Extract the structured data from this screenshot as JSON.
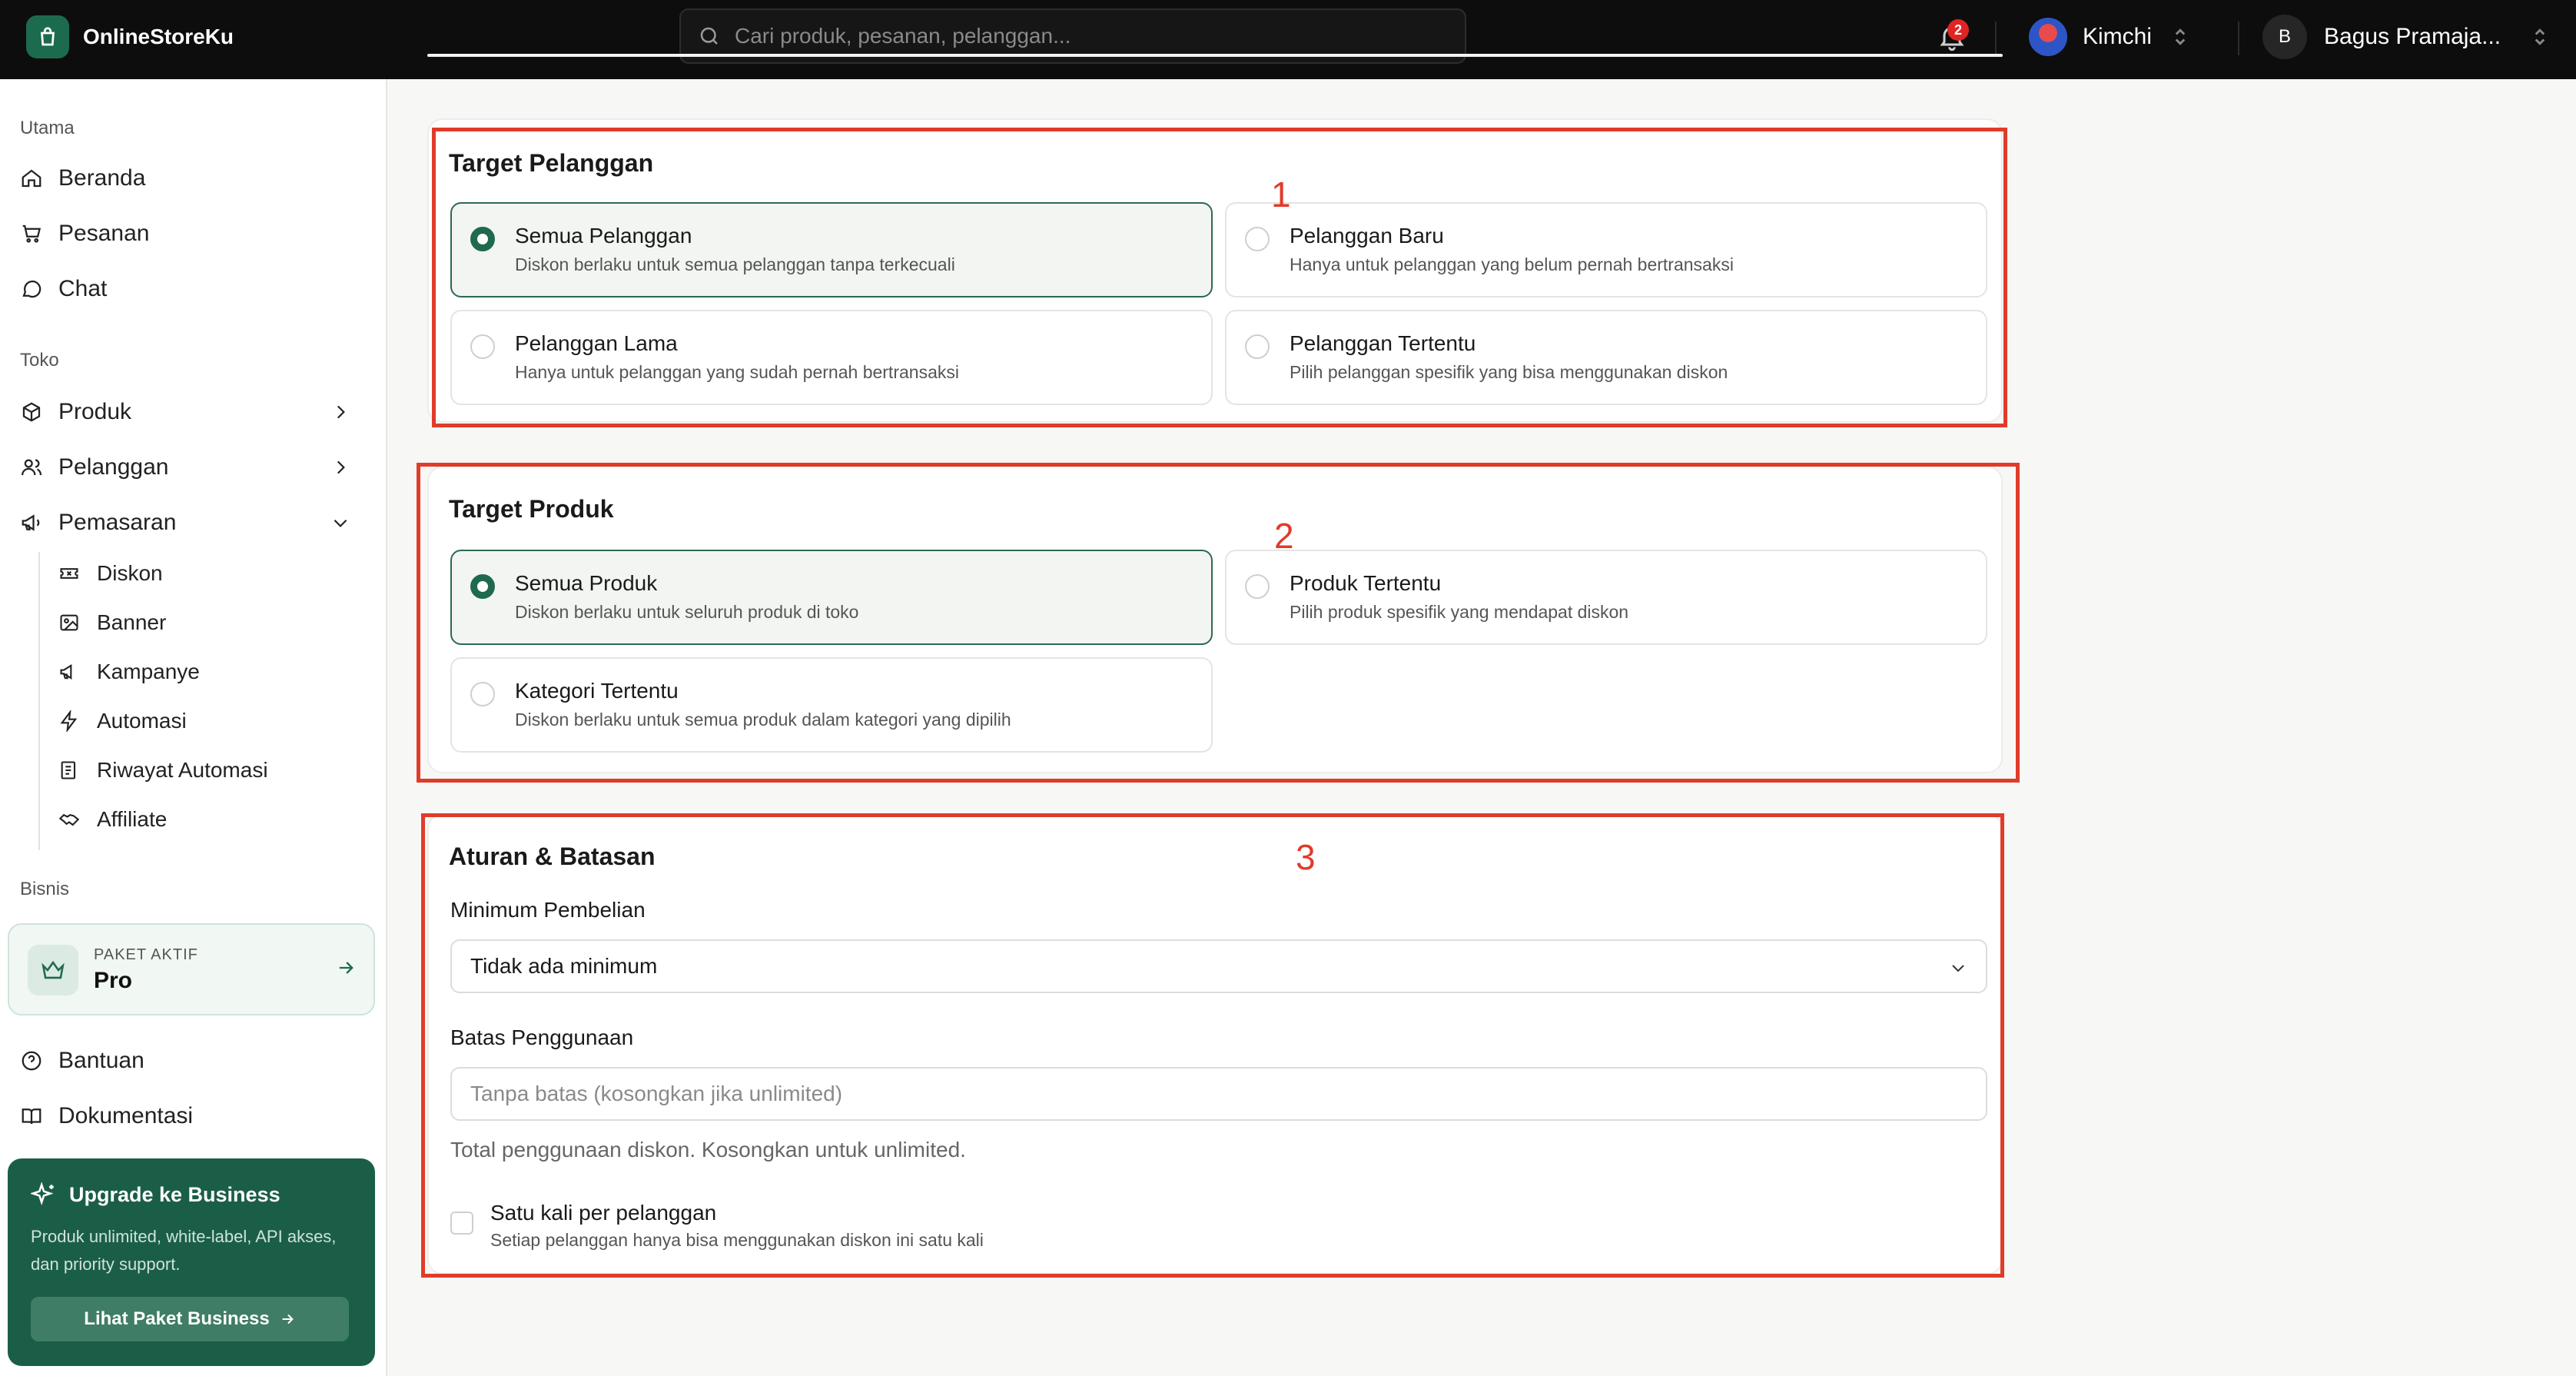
{
  "header": {
    "brand": "OnlineStoreKu",
    "search_placeholder": "Cari produk, pesanan, pelanggan...",
    "notif_count": "2",
    "store_name": "Kimchi",
    "user_initial": "B",
    "user_name": "Bagus Pramaja..."
  },
  "sidebar": {
    "section_main": "Utama",
    "beranda": "Beranda",
    "pesanan": "Pesanan",
    "chat": "Chat",
    "section_store": "Toko",
    "produk": "Produk",
    "pelanggan": "Pelanggan",
    "pemasaran": "Pemasaran",
    "sub": {
      "diskon": "Diskon",
      "banner": "Banner",
      "kampanye": "Kampanye",
      "automasi": "Automasi",
      "riwayat": "Riwayat Automasi",
      "affiliate": "Affiliate"
    },
    "section_business": "Bisnis",
    "plan_caption": "PAKET AKTIF",
    "plan_name": "Pro",
    "bantuan": "Bantuan",
    "dokumentasi": "Dokumentasi",
    "upgrade_title": "Upgrade ke Business",
    "upgrade_desc": "Produk unlimited, white-label, API akses, dan priority support.",
    "upgrade_button": "Lihat Paket Business"
  },
  "target_pelanggan": {
    "title": "Target Pelanggan",
    "options": [
      {
        "title": "Semua Pelanggan",
        "desc": "Diskon berlaku untuk semua pelanggan tanpa terkecuali",
        "selected": true
      },
      {
        "title": "Pelanggan Baru",
        "desc": "Hanya untuk pelanggan yang belum pernah bertransaksi",
        "selected": false
      },
      {
        "title": "Pelanggan Lama",
        "desc": "Hanya untuk pelanggan yang sudah pernah bertransaksi",
        "selected": false
      },
      {
        "title": "Pelanggan Tertentu",
        "desc": "Pilih pelanggan spesifik yang bisa menggunakan diskon",
        "selected": false
      }
    ]
  },
  "target_produk": {
    "title": "Target Produk",
    "options": [
      {
        "title": "Semua Produk",
        "desc": "Diskon berlaku untuk seluruh produk di toko",
        "selected": true
      },
      {
        "title": "Produk Tertentu",
        "desc": "Pilih produk spesifik yang mendapat diskon",
        "selected": false
      },
      {
        "title": "Kategori Tertentu",
        "desc": "Diskon berlaku untuk semua produk dalam kategori yang dipilih",
        "selected": false
      }
    ]
  },
  "aturan": {
    "title": "Aturan & Batasan",
    "min_label": "Minimum Pembelian",
    "min_value": "Tidak ada minimum",
    "limit_label": "Batas Penggunaan",
    "limit_placeholder": "Tanpa batas (kosongkan jika unlimited)",
    "limit_help": "Total penggunaan diskon. Kosongkan untuk unlimited.",
    "once_title": "Satu kali per pelanggan",
    "once_desc": "Setiap pelanggan hanya bisa menggunakan diskon ini satu kali"
  },
  "annotations": [
    "1",
    "2",
    "3"
  ],
  "colors": {
    "accent": "#1f6a4f",
    "annotation": "#e13b2a",
    "header": "#0d0d0d"
  }
}
